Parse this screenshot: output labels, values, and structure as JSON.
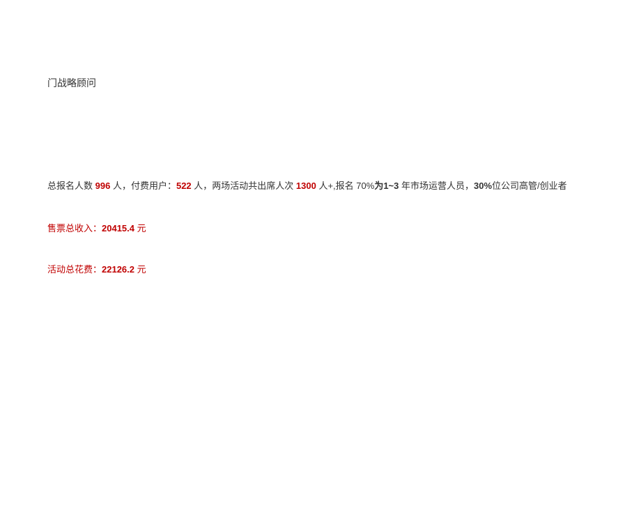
{
  "title": {
    "text": "门战略顾问"
  },
  "stats": {
    "prefix1": "总报名人数 ",
    "total_signup": "996",
    "unit1": " 人",
    "prefix2": "，付费用户：",
    "paid_users": "522",
    "unit2": " 人",
    "prefix3": "，两场活动共出席人次 ",
    "attendance": "1300",
    "suffix3": " 人+,报名 ",
    "pct1_prefix": "70%",
    "pct1_label": "为",
    "years": "1~3",
    "pct1_suffix": " 年市场运营人员，",
    "pct2": "30%",
    "pct2_suffix": "位公司高管/创业者"
  },
  "income": {
    "label": "售票总收入：",
    "value": "20415.4",
    "unit": " 元"
  },
  "expense": {
    "label": "活动总花费：",
    "value": "22126.2",
    "unit": " 元"
  }
}
